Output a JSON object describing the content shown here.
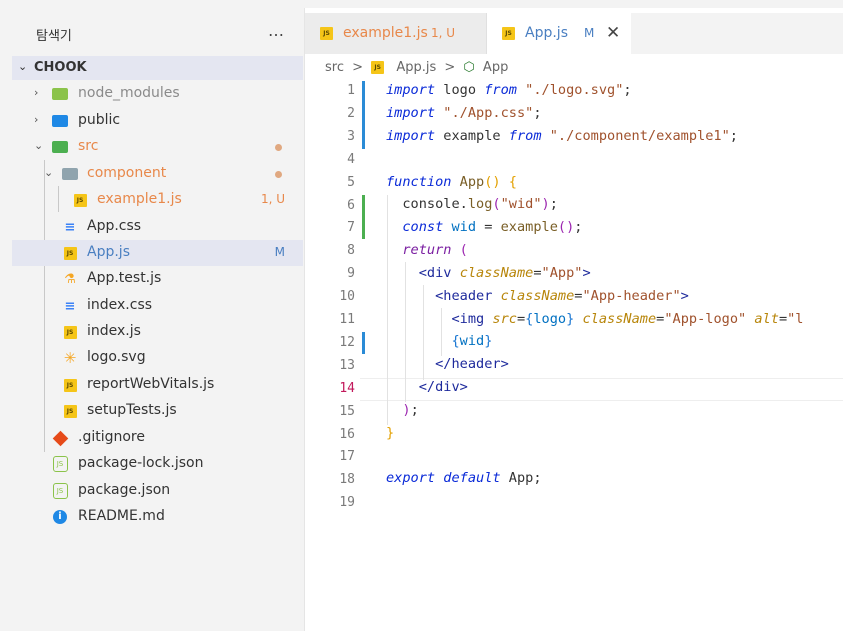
{
  "explorer": {
    "title": "탐색기",
    "more_icon": "…",
    "section": "CHOOK"
  },
  "tree": [
    {
      "label": "node_modules",
      "type": "folder",
      "icon": "folder-node-icon",
      "expanded": false,
      "dimmed": true
    },
    {
      "label": "public",
      "type": "folder",
      "icon": "folder-public-icon",
      "expanded": false
    },
    {
      "label": "src",
      "type": "folder",
      "icon": "folder-src-icon",
      "expanded": true,
      "modified_dot": true
    },
    {
      "label": "component",
      "type": "folder",
      "icon": "folder-icon",
      "expanded": true,
      "modified_dot": true
    },
    {
      "label": "example1.js",
      "type": "file",
      "icon": "js-icon",
      "badge": "1, U"
    },
    {
      "label": "App.css",
      "type": "file",
      "icon": "css-icon"
    },
    {
      "label": "App.js",
      "type": "file",
      "icon": "js-icon",
      "badge": "M",
      "selected": true
    },
    {
      "label": "App.test.js",
      "type": "file",
      "icon": "test-flask-icon"
    },
    {
      "label": "index.css",
      "type": "file",
      "icon": "css-icon"
    },
    {
      "label": "index.js",
      "type": "file",
      "icon": "js-icon"
    },
    {
      "label": "logo.svg",
      "type": "file",
      "icon": "svg-star-icon"
    },
    {
      "label": "reportWebVitals.js",
      "type": "file",
      "icon": "js-icon"
    },
    {
      "label": "setupTests.js",
      "type": "file",
      "icon": "js-icon"
    },
    {
      "label": ".gitignore",
      "type": "file",
      "icon": "git-icon"
    },
    {
      "label": "package-lock.json",
      "type": "file",
      "icon": "node-json-icon"
    },
    {
      "label": "package.json",
      "type": "file",
      "icon": "node-json-icon"
    },
    {
      "label": "README.md",
      "type": "file",
      "icon": "info-icon"
    }
  ],
  "tabs": [
    {
      "label": "example1.js",
      "status": "1, U",
      "active": false
    },
    {
      "label": "App.js",
      "status": "M",
      "active": true,
      "close": "✕"
    }
  ],
  "breadcrumb": {
    "folder": "src",
    "file": "App.js",
    "symbol": "App",
    "separator": ">"
  },
  "editor": {
    "current_line": 14,
    "line_numbers": [
      "1",
      "2",
      "3",
      "4",
      "5",
      "6",
      "7",
      "8",
      "9",
      "10",
      "11",
      "12",
      "13",
      "14",
      "15",
      "16",
      "17",
      "18",
      "19"
    ],
    "lines": [
      "import logo from \"./logo.svg\";",
      "import \"./App.css\";",
      "import example from \"./component/example1\";",
      "",
      "function App() {",
      "  console.log(\"wid\");",
      "  const wid = example();",
      "  return (",
      "    <div className=\"App\">",
      "      <header className=\"App-header\">",
      "        <img src={logo} className=\"App-logo\" alt=\"l",
      "        {wid}",
      "      </header>",
      "    </div>",
      "  );",
      "}",
      "",
      "export default App;",
      ""
    ]
  },
  "colors": {
    "selection": "#e4e6f1",
    "untracked": "#e8884a",
    "modified": "#9a8a2a",
    "modified_badge": "#4a7fc1",
    "js_yellow": "#f5c518",
    "css_blue": "#3b82f6",
    "current_line_number": "#c2185b"
  }
}
